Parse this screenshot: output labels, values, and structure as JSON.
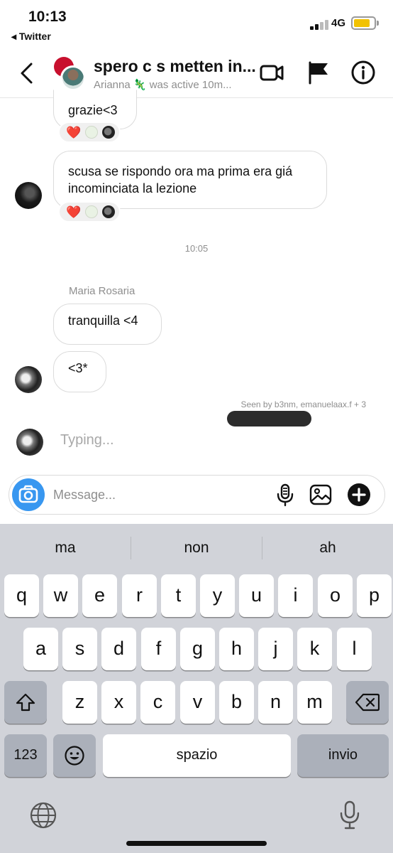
{
  "status_bar": {
    "time": "10:13",
    "back_app": "◂ Twitter",
    "network": "4G",
    "battery_color": "#f2c200"
  },
  "header": {
    "title": "spero c s metten in...",
    "subtitle": "Arianna 🦎 was active 10m...",
    "icons": [
      "back-chevron-icon",
      "video-call-icon",
      "flag-icon",
      "info-icon"
    ]
  },
  "messages": [
    {
      "text": "grazie<3",
      "reactions": "❤️"
    },
    {
      "text": "scusa se rispondo ora ma prima era giá incominciata la lezione",
      "reactions": "❤️"
    },
    {
      "timestamp": "10:05"
    },
    {
      "sender": "Maria Rosaria",
      "text": "tranquilla <4"
    },
    {
      "text": "<3*"
    }
  ],
  "seen": "Seen by b3nm, emanuelaax.f + 3",
  "typing": "Typing...",
  "composer": {
    "placeholder": "Message...",
    "icons": [
      "camera-icon",
      "microphone-icon",
      "gallery-icon",
      "plus-icon"
    ]
  },
  "keyboard": {
    "suggestions": [
      "ma",
      "non",
      "ah"
    ],
    "rows": [
      [
        "q",
        "w",
        "e",
        "r",
        "t",
        "y",
        "u",
        "i",
        "o",
        "p"
      ],
      [
        "a",
        "s",
        "d",
        "f",
        "g",
        "h",
        "j",
        "k",
        "l"
      ],
      [
        "z",
        "x",
        "c",
        "v",
        "b",
        "n",
        "m"
      ]
    ],
    "numbers_key": "123",
    "space_key": "spazio",
    "return_key": "invio",
    "icons": [
      "shift-icon",
      "backspace-icon",
      "emoji-icon",
      "globe-icon",
      "dictation-icon"
    ]
  },
  "colors": {
    "accent": "#3897f0",
    "heart": "#e0245e",
    "keyboard_bg": "#d1d3d9"
  }
}
